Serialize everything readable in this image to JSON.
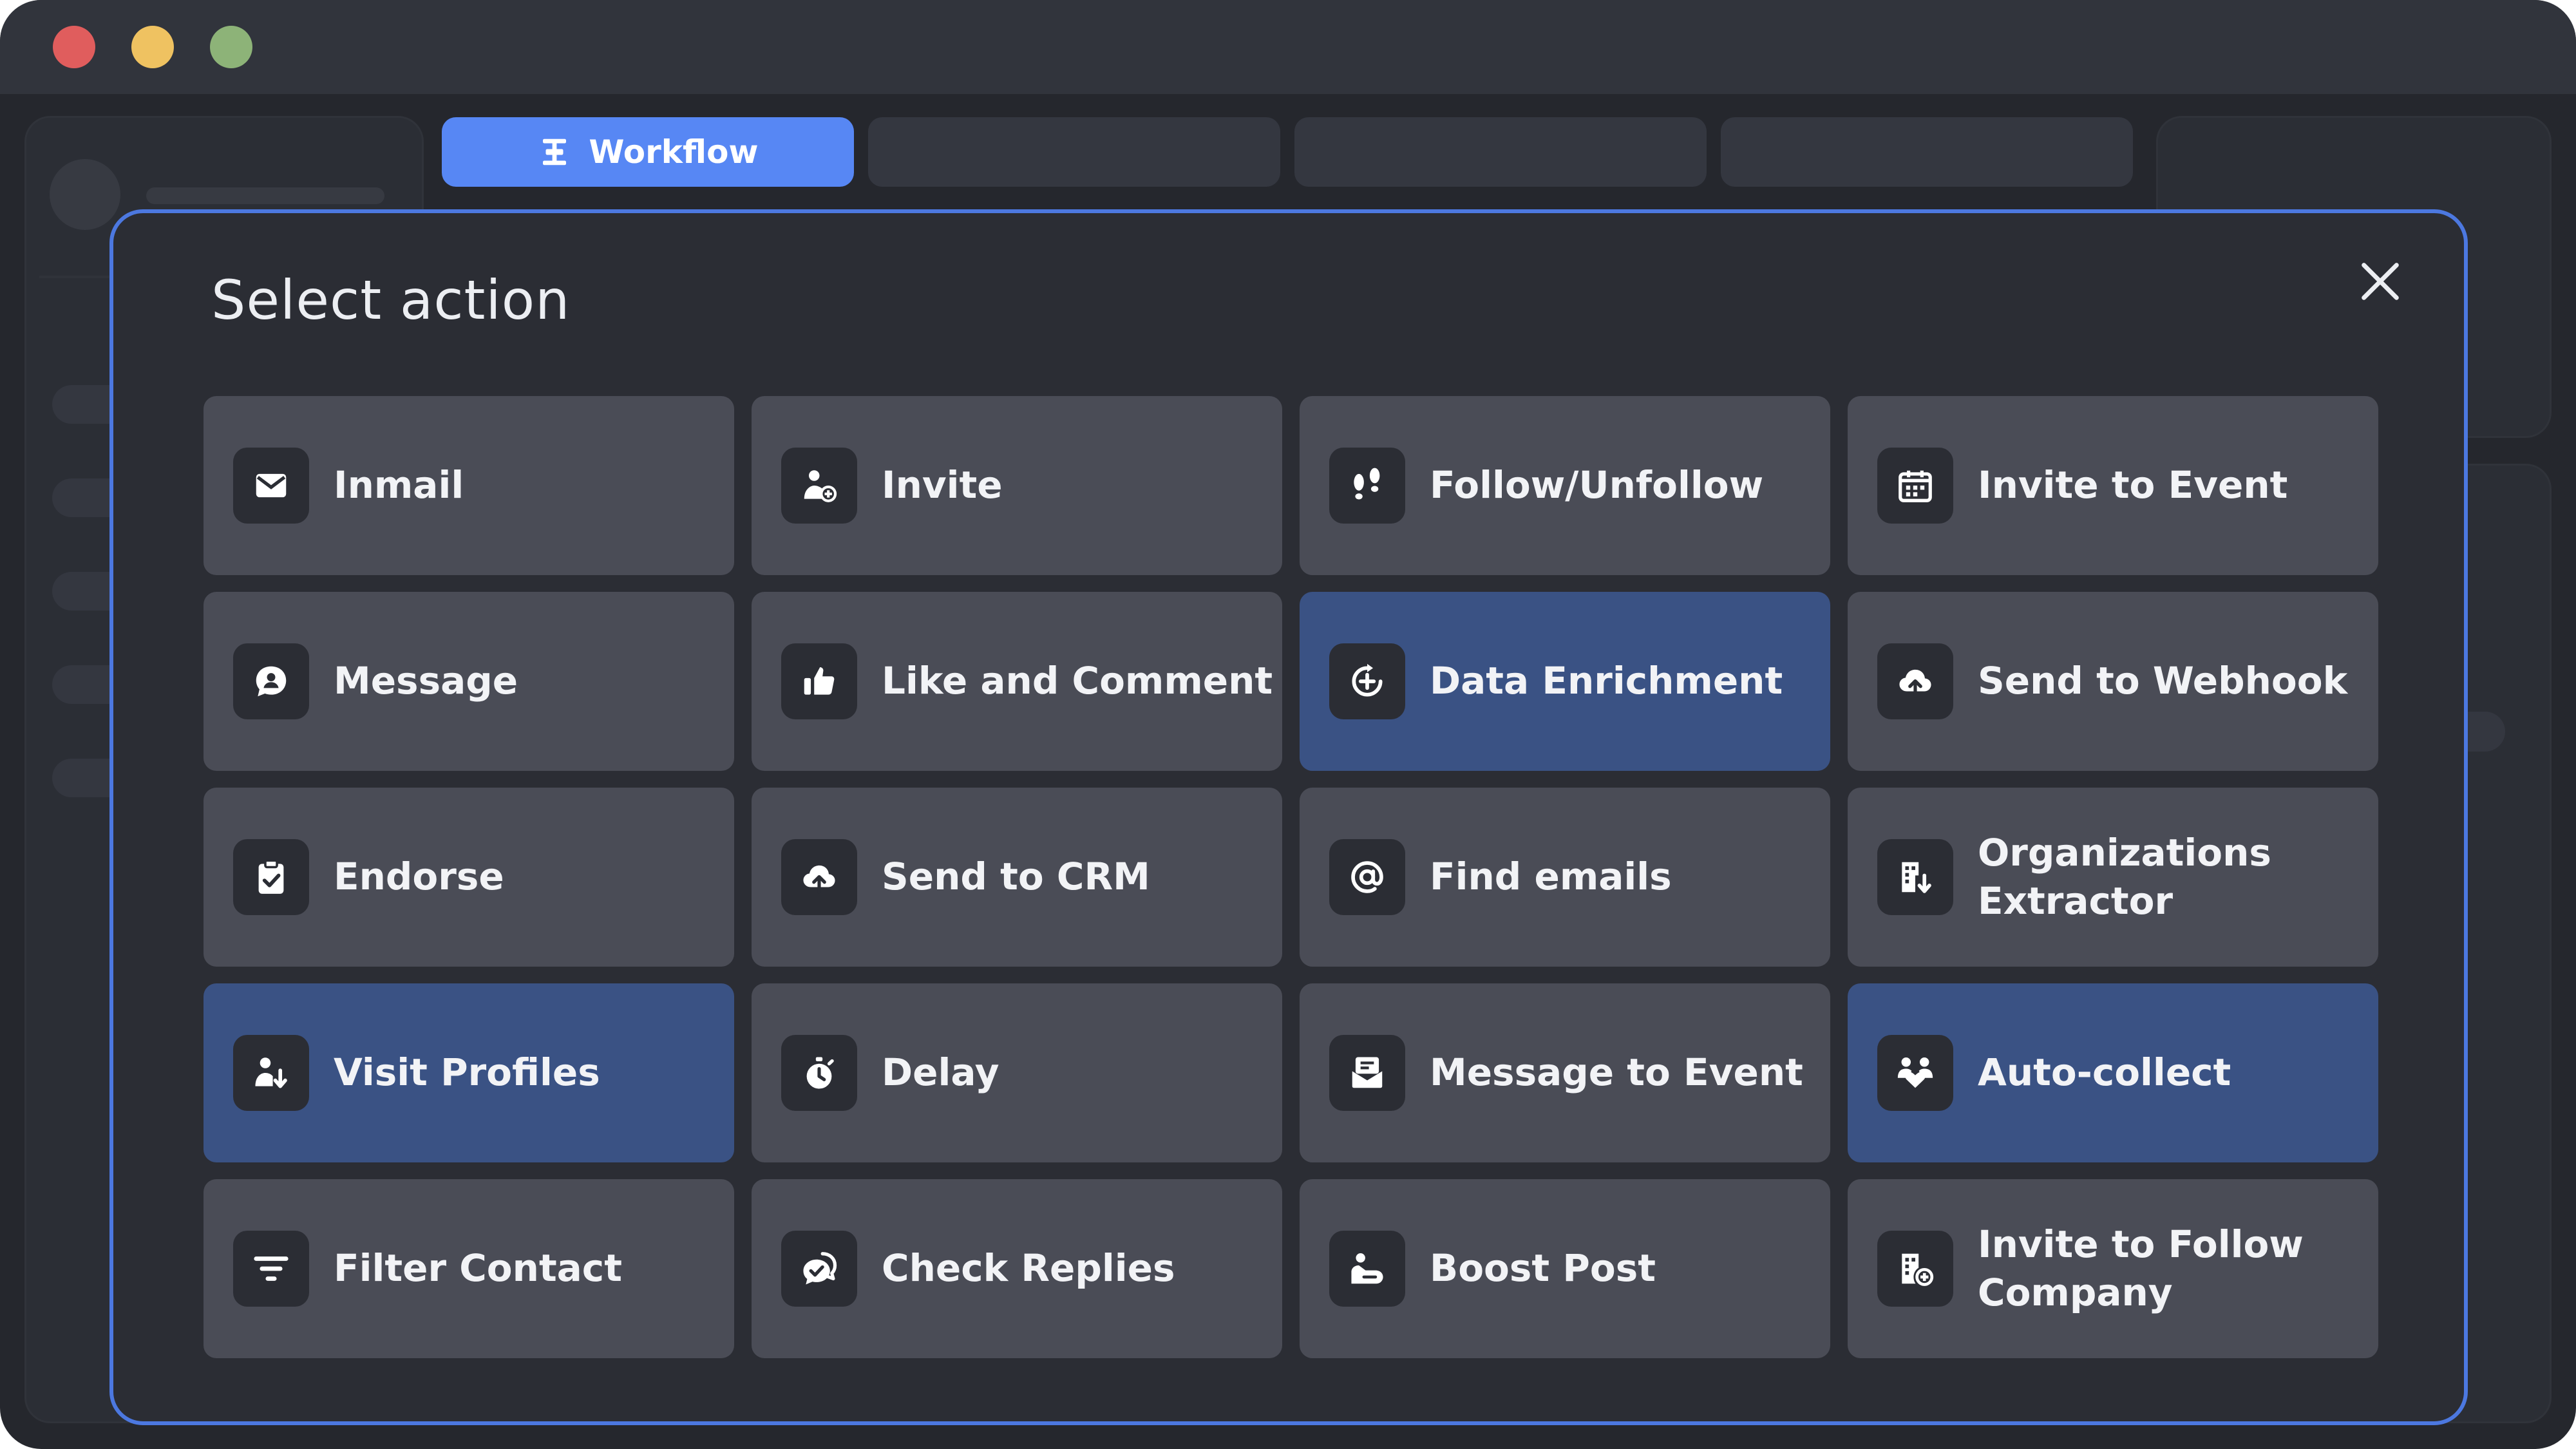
{
  "window": {
    "controls": [
      "close",
      "minimize",
      "zoom"
    ]
  },
  "tabs": [
    {
      "label": "Workflow",
      "icon": "workflow-icon",
      "active": true
    },
    {
      "label": "",
      "active": false
    },
    {
      "label": "",
      "active": false
    },
    {
      "label": "",
      "active": false
    }
  ],
  "modal": {
    "title": "Select action",
    "close_icon": "close-icon",
    "actions": [
      {
        "label": "Inmail",
        "icon": "mail-icon",
        "selected": false
      },
      {
        "label": "Invite",
        "icon": "add-person-icon",
        "selected": false
      },
      {
        "label": "Follow/Unfollow",
        "icon": "footprints-icon",
        "selected": false
      },
      {
        "label": "Invite to Event",
        "icon": "calendar-icon",
        "selected": false
      },
      {
        "label": "Message",
        "icon": "chat-person-icon",
        "selected": false
      },
      {
        "label": "Like and Comment",
        "icon": "thumbs-up-icon",
        "selected": false
      },
      {
        "label": "Data Enrichment",
        "icon": "enrich-icon",
        "selected": true
      },
      {
        "label": "Send to Webhook",
        "icon": "cloud-upload-icon",
        "selected": false
      },
      {
        "label": "Endorse",
        "icon": "clipboard-check-icon",
        "selected": false
      },
      {
        "label": "Send to CRM",
        "icon": "cloud-upload-icon",
        "selected": false
      },
      {
        "label": "Find emails",
        "icon": "at-sign-icon",
        "selected": false
      },
      {
        "label": "Organizations Extractor",
        "icon": "building-download-icon",
        "selected": false
      },
      {
        "label": "Visit Profiles",
        "icon": "person-arrow-icon",
        "selected": true
      },
      {
        "label": "Delay",
        "icon": "timer-icon",
        "selected": false
      },
      {
        "label": "Message to Event",
        "icon": "envelope-event-icon",
        "selected": false
      },
      {
        "label": "Auto-collect",
        "icon": "people-heart-icon",
        "selected": true
      },
      {
        "label": "Filter Contact",
        "icon": "filter-icon",
        "selected": false
      },
      {
        "label": "Check Replies",
        "icon": "chat-check-icon",
        "selected": false
      },
      {
        "label": "Boost Post",
        "icon": "hand-boost-icon",
        "selected": false
      },
      {
        "label": "Invite to Follow Company",
        "icon": "building-add-icon",
        "selected": false
      }
    ]
  },
  "colors": {
    "accent": "#5787f4",
    "modal_border": "#4c78e0",
    "card": "#4a4c56",
    "card_selected": "#3a5284",
    "background": "#25272d"
  }
}
